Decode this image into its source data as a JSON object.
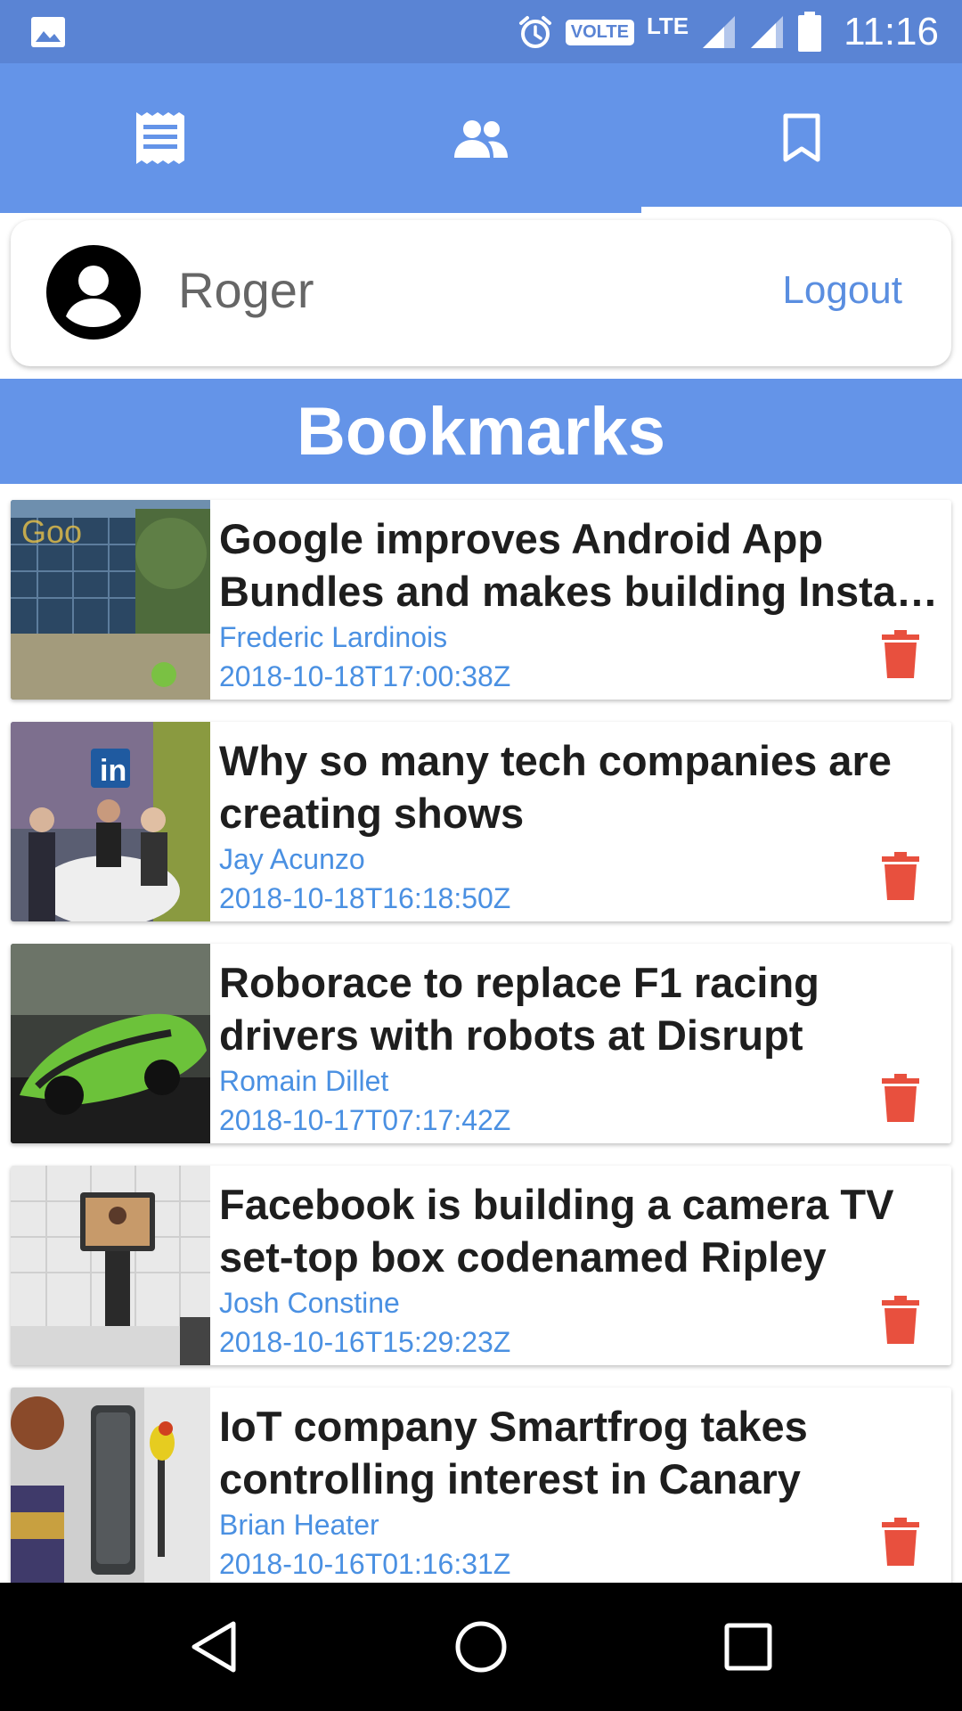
{
  "status_bar": {
    "time": "11:16",
    "volte_label": "VOLTE",
    "network_label": "LTE",
    "icons": [
      "gallery-icon",
      "alarm-icon",
      "signal-icon",
      "signal-icon",
      "battery-icon"
    ]
  },
  "tabs": [
    {
      "icon": "receipt-list-icon",
      "active": false
    },
    {
      "icon": "people-icon",
      "active": false
    },
    {
      "icon": "bookmark-icon",
      "active": true
    }
  ],
  "profile": {
    "avatar_icon": "account-circle-icon",
    "username": "Roger",
    "logout_label": "Logout"
  },
  "section": {
    "title": "Bookmarks"
  },
  "bookmarks": [
    {
      "title": "Google improves Android App Bundles and makes building Instant Apps easier",
      "author": "Frederic Lardinois",
      "date": "2018-10-18T17:00:38Z"
    },
    {
      "title": "Why so many tech companies are creating shows",
      "author": "Jay Acunzo",
      "date": "2018-10-18T16:18:50Z"
    },
    {
      "title": "Roborace to replace F1 racing drivers with robots at Disrupt",
      "author": "Romain Dillet",
      "date": "2018-10-17T07:17:42Z"
    },
    {
      "title": "Facebook is building a camera TV set-top box codenamed Ripley",
      "author": "Josh Constine",
      "date": "2018-10-16T15:29:23Z"
    },
    {
      "title": "IoT company Smartfrog takes controlling interest in Canary",
      "author": "Brian Heater",
      "date": "2018-10-16T01:16:31Z"
    }
  ],
  "nav_bar": {
    "icons": [
      "back-icon",
      "home-icon",
      "recents-icon"
    ]
  },
  "colors": {
    "status_bar": "#5a84d4",
    "primary": "#6494e8",
    "link": "#4a90e2",
    "delete": "#e8503e"
  }
}
